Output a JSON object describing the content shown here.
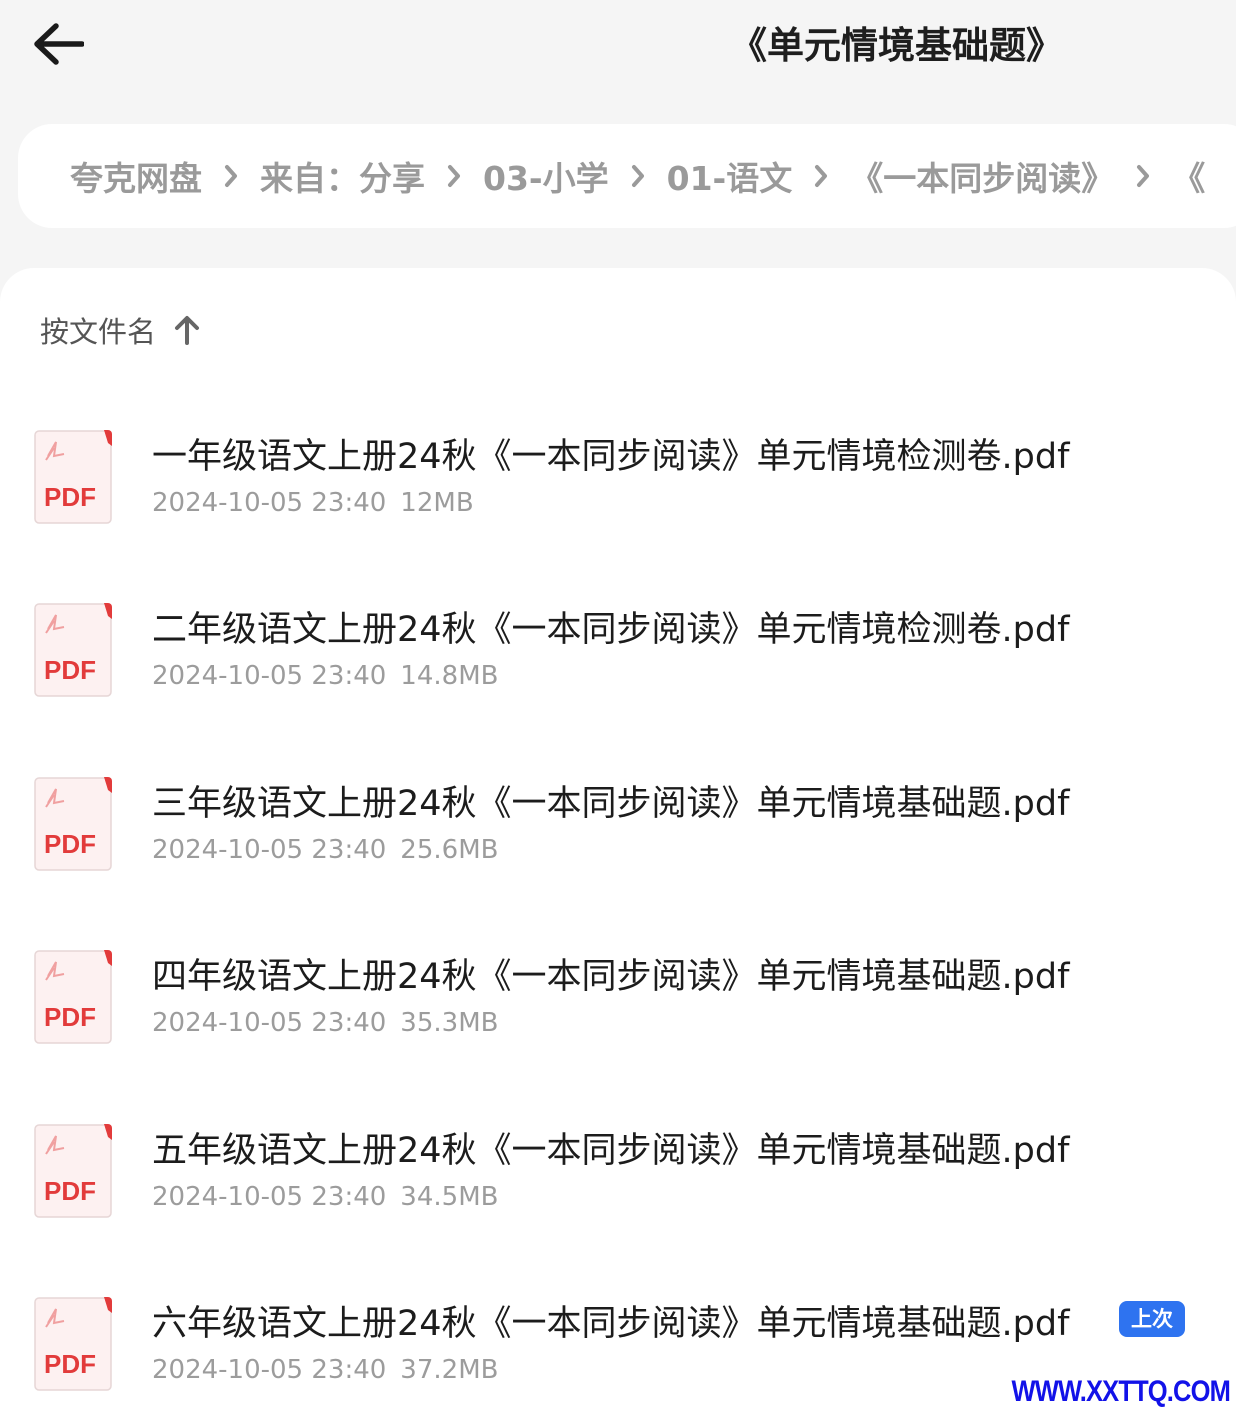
{
  "header": {
    "title": "《单元情境基础题》"
  },
  "breadcrumb": [
    "夸克网盘",
    "来自：分享",
    "03-小学",
    "01-语文",
    "《一本同步阅读》",
    "《"
  ],
  "sort": {
    "label": "按文件名"
  },
  "files": [
    {
      "name": "一年级语文上册24秋《一本同步阅读》单元情境检测卷.pdf",
      "date": "2024-10-05 23:40",
      "size": "12MB",
      "icon_label": "PDF"
    },
    {
      "name": "二年级语文上册24秋《一本同步阅读》单元情境检测卷.pdf",
      "date": "2024-10-05 23:40",
      "size": "14.8MB",
      "icon_label": "PDF"
    },
    {
      "name": "三年级语文上册24秋《一本同步阅读》单元情境基础题.pdf",
      "date": "2024-10-05 23:40",
      "size": "25.6MB",
      "icon_label": "PDF"
    },
    {
      "name": "四年级语文上册24秋《一本同步阅读》单元情境基础题.pdf",
      "date": "2024-10-05 23:40",
      "size": "35.3MB",
      "icon_label": "PDF"
    },
    {
      "name": "五年级语文上册24秋《一本同步阅读》单元情境基础题.pdf",
      "date": "2024-10-05 23:40",
      "size": "34.5MB",
      "icon_label": "PDF"
    },
    {
      "name": "六年级语文上册24秋《一本同步阅读》单元情境基础题.pdf",
      "date": "2024-10-05 23:40",
      "size": "37.2MB",
      "icon_label": "PDF",
      "badge": "上次"
    }
  ],
  "watermark": "WWW.XXTTQ.COM",
  "colors": {
    "background": "#f5f5f5",
    "card": "#ffffff",
    "pdf_red": "#e23b3b",
    "badge_blue": "#2e73f0",
    "watermark_blue": "#1212e8"
  },
  "icons": {
    "back": "arrow-left-icon",
    "separator": "chevron-right-icon",
    "sort": "arrow-up-icon",
    "file": "pdf-file-icon"
  }
}
